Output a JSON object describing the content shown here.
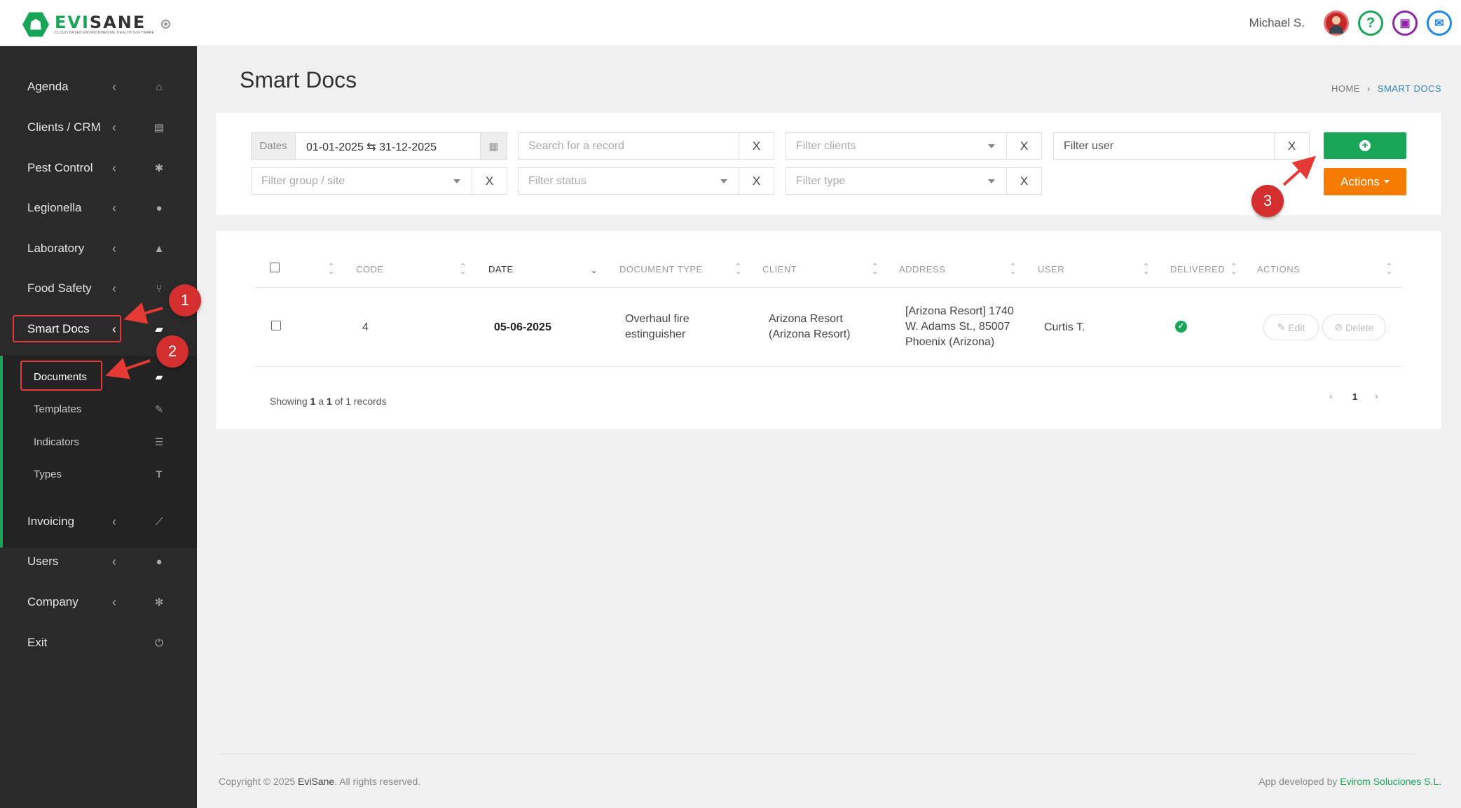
{
  "header": {
    "logo_name_accent": "EVI",
    "logo_name_rest": "SANE",
    "logo_tagline": "CLOUD BASED ENVIRONMENTAL HEALTH SOFTWARE",
    "user_name": "Michael S.",
    "icons": [
      "avatar",
      "help-icon",
      "gift-icon",
      "chat-icon"
    ]
  },
  "sidebar": {
    "items": [
      {
        "label": "Agenda",
        "icon": "home-icon"
      },
      {
        "label": "Clients / CRM",
        "icon": "id-card-icon"
      },
      {
        "label": "Pest Control",
        "icon": "bug-icon"
      },
      {
        "label": "Legionella",
        "icon": "drop-icon"
      },
      {
        "label": "Laboratory",
        "icon": "flask-icon"
      },
      {
        "label": "Food Safety",
        "icon": "cutlery-icon"
      },
      {
        "label": "Smart Docs",
        "icon": "folder-open-icon"
      },
      {
        "label": "Invoicing",
        "icon": "chart-icon"
      },
      {
        "label": "Users",
        "icon": "user-icon"
      },
      {
        "label": "Company",
        "icon": "gear-icon"
      },
      {
        "label": "Exit",
        "icon": "power-icon"
      }
    ],
    "sub_items": [
      {
        "label": "Documents",
        "icon": "folder-open-icon"
      },
      {
        "label": "Templates",
        "icon": "edit-icon"
      },
      {
        "label": "Indicators",
        "icon": "list-icon"
      },
      {
        "label": "Types",
        "icon": "text-icon"
      }
    ]
  },
  "page": {
    "title": "Smart Docs",
    "breadcrumb_home": "HOME",
    "breadcrumb_current": "SMART DOCS"
  },
  "filters": {
    "dates_label": "Dates",
    "date_range": "01-01-2025  ⇆  31-12-2025",
    "search_placeholder": "Search for a record",
    "clients_placeholder": "Filter clients",
    "user_placeholder": "Filter user",
    "group_placeholder": "Filter group / site",
    "status_placeholder": "Filter status",
    "type_placeholder": "Filter type",
    "clear_label": "X",
    "actions_label": "Actions"
  },
  "table": {
    "headers": [
      "CODE",
      "DATE",
      "DOCUMENT TYPE",
      "CLIENT",
      "ADDRESS",
      "USER",
      "DELIVERED",
      "ACTIONS"
    ],
    "rows": [
      {
        "code": "4",
        "date": "05-06-2025",
        "document_type": "Overhaul fire estinguisher",
        "client": "Arizona Resort (Arizona Resort)",
        "address": "[Arizona Resort] 1740 W. Adams St., 85007 Phoenix (Arizona)",
        "user": "Curtis T.",
        "delivered": true,
        "edit_label": "Edit",
        "delete_label": "Delete"
      }
    ],
    "showing_prefix": "Showing ",
    "showing_from": "1",
    "showing_mid": " a ",
    "showing_to": "1",
    "showing_suffix": " of 1 records",
    "current_page": "1"
  },
  "footer": {
    "copyright_prefix": "Copyright © 2025 ",
    "copyright_brand": "EviSane",
    "copyright_suffix": ". All rights reserved.",
    "developer_prefix": "App developed by ",
    "developer_brand": "Evirom Soluciones S.L."
  },
  "annotations": [
    "1",
    "2",
    "3"
  ],
  "colors": {
    "brand_green": "#18a558",
    "actions_orange": "#f57c00",
    "sidebar_bg": "#2a2a2a",
    "annotation_red": "#d32f2f"
  }
}
